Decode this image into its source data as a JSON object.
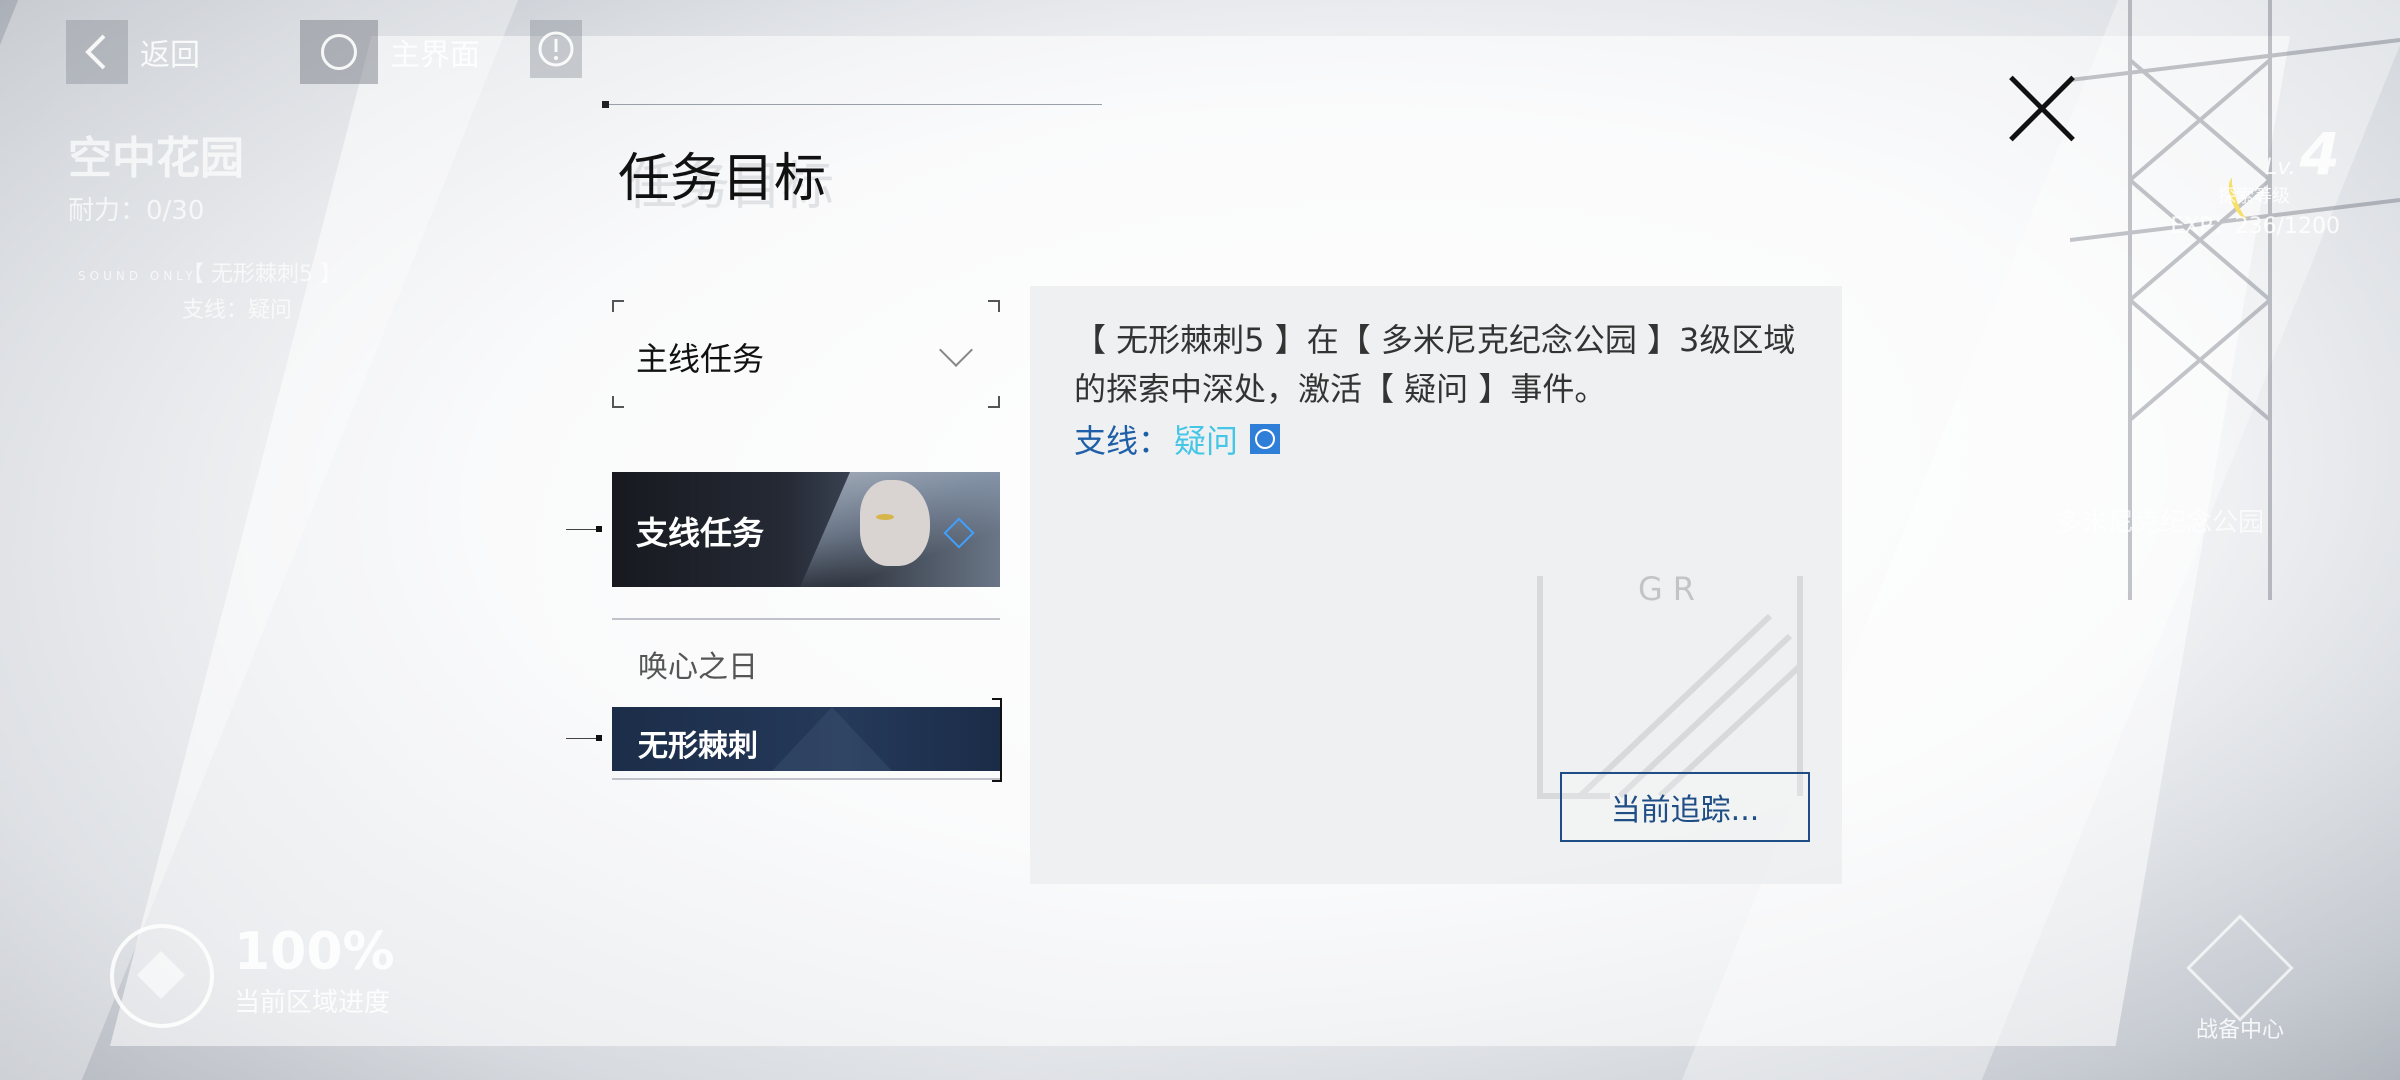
{
  "topbar": {
    "back_label": "返回",
    "home_label": "主界面"
  },
  "area": {
    "title": "空中花园",
    "stamina": "耐力：0/30",
    "sound_logo": "SOUND ONLY",
    "faint_line_1": "【 无形棘刺5 】",
    "faint_line_2": "支线：疑问",
    "faint_right": "多米尼克纪念公园"
  },
  "level": {
    "prefix": "Lv.",
    "value": "4",
    "label": "探索等级",
    "exp": "EXP：236/1200"
  },
  "progress": {
    "percent": "100%",
    "label": "当前区域进度"
  },
  "armory": {
    "label": "战备中心"
  },
  "dialog": {
    "title": "任务目标",
    "dropdown_label": "主线任务",
    "category": "支线任务",
    "tasks": [
      {
        "label": "唤心之日",
        "selected": false
      },
      {
        "label": "无形棘刺",
        "selected": true
      }
    ],
    "description": "【 无形棘刺5 】在【 多米尼克纪念公园 】3级区域的探索中深处，激活【 疑问 】事件。",
    "branch_key": "支线：",
    "branch_value": "疑问",
    "track_button": "当前追踪...",
    "watermark": "GR"
  },
  "colors": {
    "accent_blue": "#1f5fa8",
    "branch_cyan": "#45c6e6",
    "task_selected_bg": "#1b2d48"
  }
}
